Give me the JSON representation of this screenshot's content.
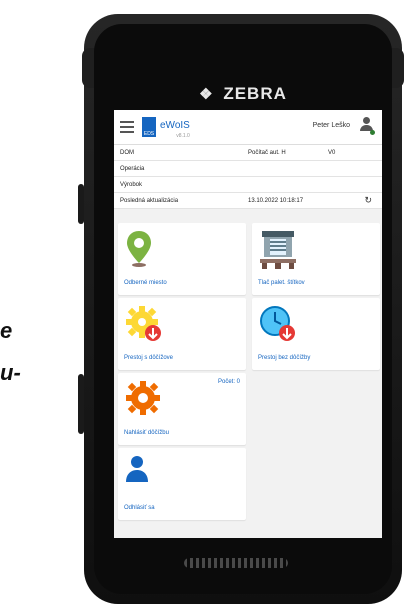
{
  "side_text": [
    "e",
    "u-"
  ],
  "device": {
    "brand": "ZEBRA"
  },
  "app": {
    "title": "eWoIS",
    "version": "v8.1.0",
    "logo_text": "EDS",
    "user_name": "Peter Leško",
    "user_status_color": "#2e7d32",
    "accent_color": "#1565c0"
  },
  "info_rows": [
    {
      "c1": "DOM",
      "c2": "Počítač aut. H",
      "c3": "V0"
    },
    {
      "c1": "Operácia",
      "c2": "",
      "c3": ""
    },
    {
      "c1": "Výrobok",
      "c2": "",
      "c3": ""
    },
    {
      "c1": "Posledná aktualizácia",
      "c2": "13.10.2022 10:18:17",
      "c3": ""
    }
  ],
  "tiles": [
    {
      "label": "Odberné miesto",
      "icon": "location-pin-icon",
      "count": ""
    },
    {
      "label": "Tlač palet. štítkov",
      "icon": "pallet-printer-icon",
      "count": ""
    },
    {
      "label": "Prestoj s dôčížove",
      "icon": "gear-down-icon",
      "count": ""
    },
    {
      "label": "Prestoj bez dôčížby",
      "icon": "clock-down-icon",
      "count": ""
    },
    {
      "label": "Nahlásiť dôčížbu",
      "icon": "gear-icon",
      "count": "Počet: 0"
    },
    {
      "label": "Odhlásiť sa",
      "icon": "person-icon",
      "count": ""
    }
  ]
}
